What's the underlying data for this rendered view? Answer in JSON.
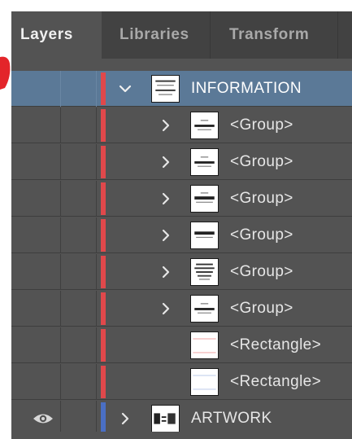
{
  "tabs": [
    {
      "label": "Layers",
      "active": true
    },
    {
      "label": "Libraries",
      "active": false
    },
    {
      "label": "Transform",
      "active": false
    }
  ],
  "colors": {
    "panel_bg": "#535353",
    "tabbar_bg": "#424242",
    "selected_row": "#5b7997",
    "layer_red": "#e0484b",
    "layer_blue": "#4a6fc4"
  },
  "layers": [
    {
      "name": "INFORMATION",
      "visible_icon": false,
      "expanded": true,
      "selected": true,
      "level": 0,
      "color": "red",
      "thumb": "info"
    },
    {
      "name": "<Group>",
      "visible_icon": false,
      "expanded": false,
      "selected": false,
      "level": 1,
      "color": "red",
      "thumb": "g1"
    },
    {
      "name": "<Group>",
      "visible_icon": false,
      "expanded": false,
      "selected": false,
      "level": 1,
      "color": "red",
      "thumb": "g2"
    },
    {
      "name": "<Group>",
      "visible_icon": false,
      "expanded": false,
      "selected": false,
      "level": 1,
      "color": "red",
      "thumb": "g3"
    },
    {
      "name": "<Group>",
      "visible_icon": false,
      "expanded": false,
      "selected": false,
      "level": 1,
      "color": "red",
      "thumb": "g4"
    },
    {
      "name": "<Group>",
      "visible_icon": false,
      "expanded": false,
      "selected": false,
      "level": 1,
      "color": "red",
      "thumb": "g5"
    },
    {
      "name": "<Group>",
      "visible_icon": false,
      "expanded": false,
      "selected": false,
      "level": 1,
      "color": "red",
      "thumb": "g6"
    },
    {
      "name": "<Rectangle>",
      "visible_icon": false,
      "expanded": null,
      "selected": false,
      "level": 1,
      "color": "red",
      "thumb": "r1"
    },
    {
      "name": "<Rectangle>",
      "visible_icon": false,
      "expanded": null,
      "selected": false,
      "level": 1,
      "color": "red",
      "thumb": "r2"
    },
    {
      "name": "ARTWORK",
      "visible_icon": true,
      "expanded": false,
      "selected": false,
      "level": 0,
      "color": "blue",
      "thumb": "art"
    }
  ],
  "icons": {
    "expand_open": "chevron-down-icon",
    "expand_closed": "chevron-right-icon",
    "visibility": "eye-icon"
  }
}
